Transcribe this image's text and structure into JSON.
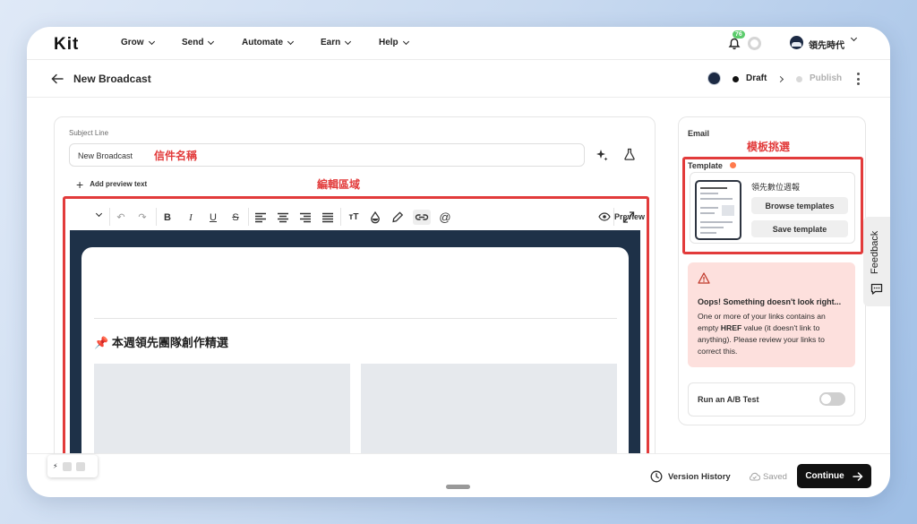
{
  "nav": {
    "logo": "Kit",
    "items": [
      {
        "label": "Grow"
      },
      {
        "label": "Send"
      },
      {
        "label": "Automate"
      },
      {
        "label": "Earn"
      },
      {
        "label": "Help"
      }
    ],
    "notification_count": "76",
    "account_name": "領先時代"
  },
  "header": {
    "title": "New Broadcast",
    "steps": [
      {
        "label": "Draft",
        "active": true
      },
      {
        "label": "Publish",
        "active": false
      }
    ]
  },
  "editor": {
    "subject_label": "Subject Line",
    "subject_value": "New Broadcast",
    "add_preview_label": "Add preview text",
    "preview_label": "Preview",
    "content_heading": "本週領先團隊創作精選",
    "content_heading_icon": "pushpin-icon"
  },
  "annotations": {
    "subject": "信件名稱",
    "editor_area": "編輯區域",
    "template": "模板挑選",
    "color": "#e23b3b"
  },
  "sidebar": {
    "email_label": "Email",
    "template_label": "Template",
    "template_name": "領先數位週報",
    "browse_label": "Browse templates",
    "save_label": "Save template",
    "alert": {
      "title": "Oops! Something doesn't look right...",
      "body_before": "One or more of your links contains an empty ",
      "body_emphasis": "HREF",
      "body_after": " value (it doesn't link to anything). Please review your links to correct this."
    },
    "ab_test_label": "Run an A/B Test",
    "ab_test_enabled": false,
    "feedback_label": "Feedback"
  },
  "footer": {
    "version_history_label": "Version History",
    "saved_label": "Saved",
    "continue_label": "Continue"
  }
}
